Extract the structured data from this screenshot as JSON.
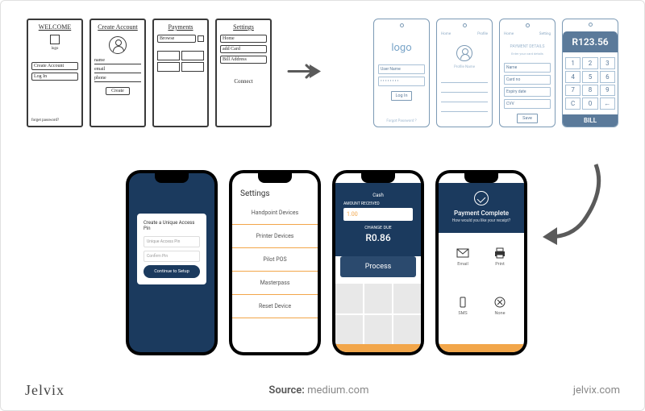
{
  "sketches": {
    "s1": {
      "title": "WELCOME",
      "logo": "logo",
      "btn1": "Create Account",
      "btn2": "Log In",
      "link": "forget password?"
    },
    "s2": {
      "title": "Create Account",
      "f1": "name",
      "f2": "email",
      "f3": "phone",
      "btn": "Create"
    },
    "s3": {
      "title": "Payments",
      "tab": "Browse"
    },
    "s4": {
      "title": "Settings",
      "i1": "Home",
      "i2": "add Card",
      "i3": "Bill Address",
      "i4": "Connect"
    }
  },
  "wires": {
    "w1": {
      "logo": "logo",
      "f1": "User Name",
      "f2": "• • • • • • • •",
      "btn": "Log In",
      "link": "Forgot Password ?"
    },
    "w2": {
      "tab1": "Home",
      "tab2": "Profile",
      "name": "Profile Name"
    },
    "w3": {
      "tab1": "Home",
      "tab2": "Setting",
      "head": "PAYMENT DETAILS",
      "sub": "Enter your card details",
      "f1": "Name",
      "f2": "Card no",
      "f3": "Expiry date",
      "f4": "CVV",
      "btn": "Save"
    },
    "w4": {
      "tab1": "Bill",
      "amount": "R123.56",
      "keys": [
        "1",
        "2",
        "3",
        "4",
        "5",
        "6",
        "7",
        "8",
        "9",
        "C",
        "0",
        "←"
      ],
      "btn": "BILL"
    }
  },
  "phones": {
    "p1": {
      "title": "Create a Unique Access Pin",
      "f1": "Unique Access Pin",
      "f2": "Confirm Pin",
      "btn": "Continue to Setup"
    },
    "p2": {
      "title": "Settings",
      "items": [
        "Handpoint Devices",
        "Printer Devices",
        "Pilot POS",
        "Masterpass",
        "Reset Device"
      ]
    },
    "p3": {
      "title": "Cash",
      "label1": "AMOUNT RECEIVED",
      "val1": "1.00",
      "label2": "CHANGE DUE",
      "val2": "R0.86",
      "btn": "Process"
    },
    "p4": {
      "title": "Payment Complete",
      "sub": "How would you like your receipt?",
      "i1": "Email",
      "i2": "Print",
      "i3": "SMS",
      "i4": "None"
    }
  },
  "footer": {
    "brand": "Jelvix",
    "source_label": "Source:",
    "source": "medium.com",
    "url": "jelvix.com"
  }
}
